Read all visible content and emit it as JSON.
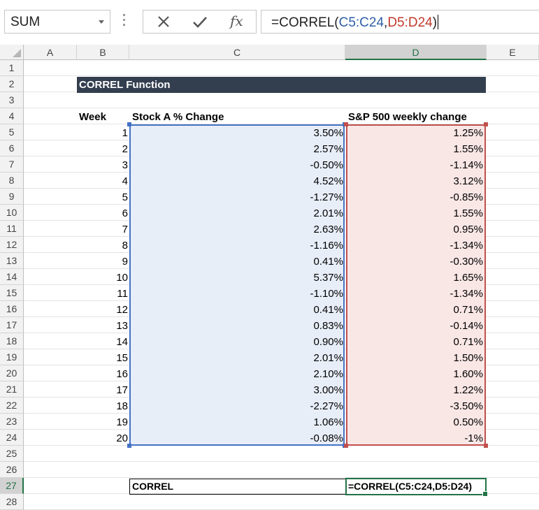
{
  "formula_bar": {
    "name_box": "SUM",
    "formula_prefix": "=CORREL(",
    "range_c": "C5:C24",
    "comma": ",",
    "range_d": "D5:D24",
    "formula_suffix": ")"
  },
  "columns": [
    "A",
    "B",
    "C",
    "D",
    "E"
  ],
  "selected_column": "D",
  "rows": [
    "1",
    "2",
    "3",
    "4",
    "5",
    "6",
    "7",
    "8",
    "9",
    "10",
    "11",
    "12",
    "13",
    "14",
    "15",
    "16",
    "17",
    "18",
    "19",
    "20",
    "21",
    "22",
    "23",
    "24",
    "25",
    "26",
    "27",
    "28"
  ],
  "selected_row": "27",
  "sheet": {
    "title": "CORREL Function",
    "header_week": "Week",
    "header_stock": "Stock A % Change",
    "header_sp": "S&P 500 weekly change",
    "weeks": [
      "1",
      "2",
      "3",
      "4",
      "5",
      "6",
      "7",
      "8",
      "9",
      "10",
      "11",
      "12",
      "13",
      "14",
      "15",
      "16",
      "17",
      "18",
      "19",
      "20"
    ],
    "stock_a": [
      "3.50%",
      "2.57%",
      "-0.50%",
      "4.52%",
      "-1.27%",
      "2.01%",
      "2.63%",
      "-1.16%",
      "0.41%",
      "5.37%",
      "-1.10%",
      "0.41%",
      "0.83%",
      "0.90%",
      "2.01%",
      "2.10%",
      "3.00%",
      "-2.27%",
      "1.06%",
      "-0.08%"
    ],
    "sp500": [
      "1.25%",
      "1.55%",
      "-1.14%",
      "3.12%",
      "-0.85%",
      "1.55%",
      "0.95%",
      "-1.34%",
      "-0.30%",
      "1.65%",
      "-1.34%",
      "0.71%",
      "-0.14%",
      "0.71%",
      "1.50%",
      "1.60%",
      "1.22%",
      "-3.50%",
      "0.50%",
      "-1%"
    ],
    "correl_label": "CORREL",
    "correl_formula": "=CORREL(C5:C24,D5:D24)"
  },
  "colors": {
    "title_bg": "#333f4f",
    "range_c": "#4472c4",
    "range_d": "#c0504d",
    "active": "#217346"
  },
  "icons": [
    "cancel-icon",
    "enter-check-icon",
    "insert-function-icon",
    "dropdown-arrow-icon"
  ]
}
